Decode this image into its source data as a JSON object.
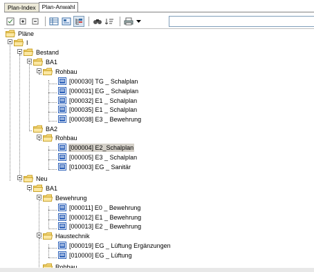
{
  "tabs": [
    {
      "label": "Plan-Index",
      "active": false
    },
    {
      "label": "Plan-Anwahl",
      "active": true
    }
  ],
  "toolbar": {
    "icons": [
      "refresh-icon",
      "expand-all-icon",
      "collapse-all-icon",
      "grid-view-icon",
      "properties-icon",
      "tree-filter-icon",
      "find-icon",
      "sort-icon",
      "print-icon",
      "dropdown-arrow-icon"
    ],
    "search_value": ""
  },
  "tree": {
    "n0": "Pläne",
    "n1": "I",
    "n2": "Bestand",
    "n3": "BA1",
    "n4": "Rohbau",
    "n5": "[000030] TG _ Schalplan",
    "n6": "[000031] EG _ Schalplan",
    "n7": "[000032] E1 _ Schalplan",
    "n8": "[000035] E1 _ Schalplan",
    "n9": "[000038] E3 _ Bewehrung",
    "n10": "BA2",
    "n11": "Rohbau",
    "n12": "[000004] E2_Schalplan",
    "n13": "[000005] E3 _ Schalplan",
    "n14": "[010003] EG _ Sanitär",
    "n15": "Neu",
    "n16": "BA1",
    "n17": "Bewehrung",
    "n18": "[000011] E0 _ Bewehrung",
    "n19": "[000012] E1 _ Bewehrung",
    "n20": "[000013] E2 _ Bewehrung",
    "n21": "Haustechnik",
    "n22": "[000019] EG _ Lüftung Ergänzungen",
    "n23": "[010000] EG _ Lüftung",
    "n24": "Rohbau"
  },
  "colors": {
    "folder": "#f5d77a",
    "folder_edge": "#c9a227",
    "doc": "#2a5fb8",
    "selected": "#d4d0c8"
  }
}
